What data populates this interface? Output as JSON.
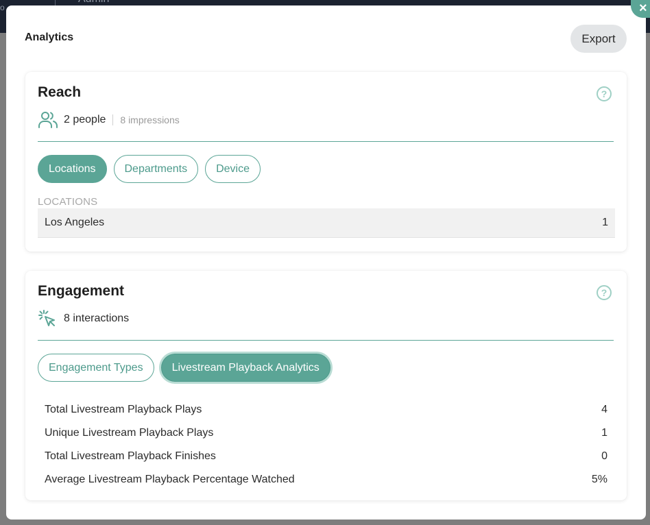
{
  "backdrop": {
    "crumb": "Admin",
    "edge": "o"
  },
  "modal": {
    "title": "Analytics",
    "export_label": "Export",
    "close_glyph": "×"
  },
  "reach": {
    "title": "Reach",
    "help_glyph": "?",
    "people": "2 people",
    "impressions": "8 impressions",
    "tabs": [
      {
        "label": "Locations",
        "active": true
      },
      {
        "label": "Departments",
        "active": false
      },
      {
        "label": "Device",
        "active": false
      }
    ],
    "locations_label": "LOCATIONS",
    "locations": [
      {
        "name": "Los Angeles",
        "count": "1"
      }
    ]
  },
  "engagement": {
    "title": "Engagement",
    "help_glyph": "?",
    "interactions": "8 interactions",
    "tabs": [
      {
        "label": "Engagement Types",
        "active": false
      },
      {
        "label": "Livestream Playback Analytics",
        "active": true
      }
    ],
    "metrics": [
      {
        "label": "Total Livestream Playback Plays",
        "value": "4"
      },
      {
        "label": "Unique Livestream Playback Plays",
        "value": "1"
      },
      {
        "label": "Total Livestream Playback Finishes",
        "value": "0"
      },
      {
        "label": "Average Livestream Playback Percentage Watched",
        "value": "5%"
      }
    ]
  },
  "colors": {
    "accent": "#5ba596",
    "accent_light": "#9fd0c5",
    "export_bg": "#e3e5e7"
  },
  "icons": {
    "people": "users-icon",
    "interactions": "cursor-click-icon",
    "help": "question-circle-icon",
    "close": "close-icon"
  }
}
